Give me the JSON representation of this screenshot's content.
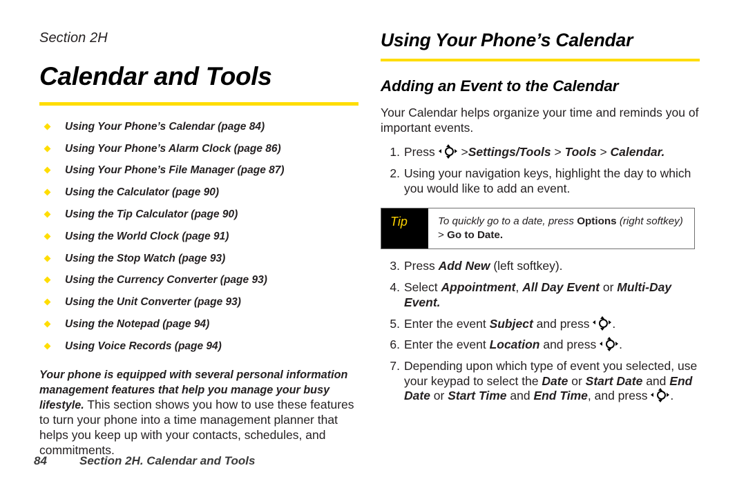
{
  "left": {
    "section_label": "Section 2H",
    "chapter_title": "Calendar and Tools",
    "toc": [
      "Using Your Phone’s Calendar (page 84)",
      "Using Your Phone’s Alarm Clock (page 86)",
      "Using Your Phone’s File Manager (page 87)",
      "Using the Calculator (page 90)",
      "Using the Tip Calculator (page 90)",
      "Using the World Clock (page 91)",
      "Using the Stop Watch (page 93)",
      "Using the Currency Converter (page 93)",
      "Using the Unit Converter (page 93)",
      "Using the Notepad (page 94)",
      "Using Voice Records (page 94)"
    ],
    "intro_lead": "Your phone is equipped with several personal information management features that help you manage your busy lifestyle.",
    "intro_rest": " This section shows you how to use these features to turn your phone into a time management planner that helps you keep up with your contacts, schedules, and commitments."
  },
  "right": {
    "heading": "Using Your Phone’s Calendar",
    "subheading": "Adding an Event to the Calendar",
    "intro": "Your Calendar helps organize your time and reminds you of important events.",
    "step1": {
      "pre": "Press ",
      "post": " >",
      "target1": "Settings/Tools",
      "sep1": " > ",
      "target2": "Tools",
      "sep2": " > ",
      "target3": "Calendar",
      "end": "."
    },
    "step2": "Using your navigation keys, highlight the day to which you would like to add an event.",
    "step3": {
      "pre": "Press ",
      "em": "Add New",
      "post": " (left softkey)."
    },
    "step4": {
      "pre": "Select ",
      "em1": "Appointment",
      "mid1": ", ",
      "em2": "All Day Event",
      "mid2": " or ",
      "em3": "Multi-Day Event",
      "post": "."
    },
    "step5": {
      "pre": "Enter the event ",
      "em": "Subject",
      "mid": " and press ",
      "post": "."
    },
    "step6": {
      "pre": "Enter the event ",
      "em": "Location",
      "mid": " and press ",
      "post": "."
    },
    "step7": {
      "pre": "Depending upon which type of event you selected, use your keypad to select the ",
      "em1": "Date",
      "mid1": " or ",
      "em2": "Start Date",
      "mid2": " and ",
      "em3": "End Date",
      "mid3": " or ",
      "em4": "Start Time",
      "mid4": " and ",
      "em5": "End Time",
      "mid5": ", and press ",
      "post": "."
    },
    "tip": {
      "label": "Tip",
      "text_1": "To quickly go to a date, press ",
      "text_bold": "Options",
      "text_2": " (right softkey)",
      "text_gt": " > ",
      "text_bold2": "Go to Date",
      "text_end": "."
    }
  },
  "footer": {
    "page_number": "84",
    "text": "Section 2H. Calendar and Tools"
  },
  "colors": {
    "accent_yellow": "#ffdd00",
    "tip_label_yellow": "#ffd400",
    "ink": "#231f20",
    "tip_border": "#6f6f6f"
  },
  "icons": {
    "navigation_key": "navigation-key-icon",
    "bullet": "diamond-bullet-icon"
  }
}
